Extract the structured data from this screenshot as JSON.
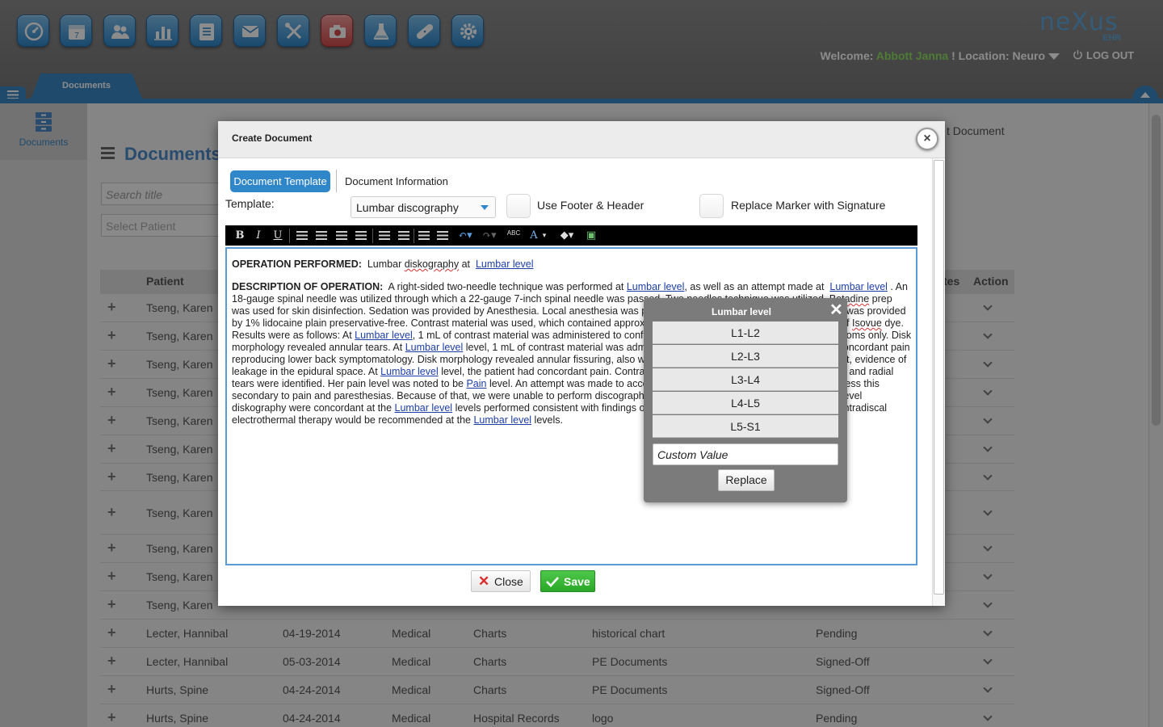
{
  "header": {
    "nav_icons": [
      {
        "name": "dashboard-icon"
      },
      {
        "name": "calendar-icon"
      },
      {
        "name": "patients-icon"
      },
      {
        "name": "reports-icon"
      },
      {
        "name": "notes-icon"
      },
      {
        "name": "mail-icon"
      },
      {
        "name": "tools-icon"
      },
      {
        "name": "camera-icon"
      },
      {
        "name": "lab-flask-icon"
      },
      {
        "name": "bandage-icon"
      },
      {
        "name": "settings-gear-icon"
      }
    ],
    "calendar_day": "7",
    "logo_text": "neXus",
    "logo_sub": "EHR",
    "welcome_label": "Welcome:",
    "user_name": "Abbott Janna",
    "location_label": "! Location: Neuro",
    "logout_label": "LOG OUT",
    "active_tab": "Documents"
  },
  "sidebar": {
    "item_label": "Documents"
  },
  "page": {
    "title": "Documents",
    "create_document_link": "t Document",
    "search_placeholder": "Search title",
    "patient_placeholder": "Select Patient",
    "columns": {
      "patient": "Patient",
      "notes": "tes",
      "action": "Action"
    }
  },
  "rows": [
    {
      "patient": "Tseng, Karen",
      "date": "",
      "category": "",
      "type": "",
      "title": "",
      "status": ""
    },
    {
      "patient": "Tseng, Karen",
      "date": "",
      "category": "",
      "type": "",
      "title": "",
      "status": ""
    },
    {
      "patient": "Tseng, Karen",
      "date": "",
      "category": "",
      "type": "",
      "title": "",
      "status": ""
    },
    {
      "patient": "Tseng, Karen",
      "date": "",
      "category": "",
      "type": "",
      "title": "",
      "status": ""
    },
    {
      "patient": "Tseng, Karen",
      "date": "",
      "category": "",
      "type": "",
      "title": "",
      "status": ""
    },
    {
      "patient": "Tseng, Karen",
      "date": "",
      "category": "",
      "type": "",
      "title": "",
      "status": ""
    },
    {
      "patient": "Tseng, Karen",
      "date": "",
      "category": "",
      "type": "",
      "title": "",
      "status": ""
    },
    {
      "patient": "Tseng, Karen",
      "date": "",
      "category": "",
      "type": "",
      "title": "",
      "status": ""
    },
    {
      "patient": "Tseng, Karen",
      "date": "",
      "category": "",
      "type": "",
      "title": "",
      "status": ""
    },
    {
      "patient": "Tseng, Karen",
      "date": "",
      "category": "",
      "type": "",
      "title": "",
      "status": ""
    },
    {
      "patient": "Tseng, Karen",
      "date": "",
      "category": "",
      "type": "",
      "title": "",
      "status": ""
    },
    {
      "patient": "Lecter, Hannibal",
      "date": "04-19-2014",
      "category": "Medical",
      "type": "Charts",
      "title": "historical chart",
      "status": "Pending"
    },
    {
      "patient": "Lecter, Hannibal",
      "date": "05-03-2014",
      "category": "Medical",
      "type": "Charts",
      "title": "PE Documents",
      "status": "Signed-Off"
    },
    {
      "patient": "Hurts, Spine",
      "date": "04-24-2014",
      "category": "Medical",
      "type": "Charts",
      "title": "PE Documents",
      "status": "Signed-Off"
    },
    {
      "patient": "Hurts, Spine",
      "date": "04-24-2014",
      "category": "Medical",
      "type": "Hospital Records",
      "title": "logo",
      "status": "Pending"
    }
  ],
  "modal": {
    "title": "Create Document",
    "tabs": {
      "template": "Document Template",
      "info": "Document Information"
    },
    "template_label": "Template:",
    "template_value": "Lumbar discography",
    "use_footer_header_label": "Use Footer & Header",
    "replace_marker_label": "Replace Marker with Signature",
    "toolbar": {
      "bold": "B",
      "italic": "I",
      "underline": "U",
      "spellcheck": "ABC",
      "font_color": "A"
    },
    "editor": {
      "op_label": "OPERATION PERFORMED:",
      "op_text_a": "Lumbar ",
      "op_text_b": "diskography",
      "op_text_c": " at ",
      "marker": "Lumbar level",
      "desc_label": "DESCRIPTION OF OPERATION:"
    },
    "close_label": "Close",
    "save_label": "Save"
  },
  "popup": {
    "title": "Lumbar level",
    "options": [
      "L1-L2",
      "L2-L3",
      "L3-L4",
      "L4-L5",
      "L5-S1"
    ],
    "custom_placeholder": "Custom Value",
    "replace_label": "Replace"
  },
  "colors": {
    "accent": "#3b88c5",
    "user_name": "#8fe063",
    "save": "#2aa727",
    "close_x": "#dd2a2a"
  }
}
